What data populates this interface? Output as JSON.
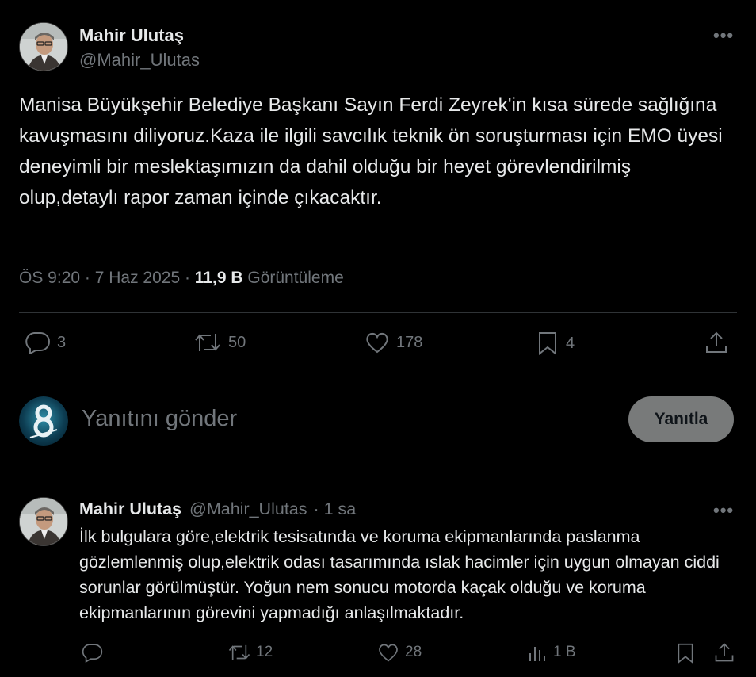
{
  "tweet": {
    "author_name": "Mahir Ulutaş",
    "author_handle": "@Mahir_Ulutas",
    "text": "Manisa Büyükşehir Belediye Başkanı Sayın Ferdi Zeyrek'in kısa sürede sağlığına kavuşmasını diliyoruz.Kaza ile ilgili savcılık teknik ön soruşturması için EMO üyesi deneyimli bir meslektaşımızın da dahil olduğu bir heyet görevlendirilmiş olup,detaylı rapor zaman içinde çıkacaktır.",
    "time": "ÖS 9:20 · 7 Haz 2025 ·",
    "views_count": "11,9 B",
    "views_label": "Görüntüleme",
    "replies": "3",
    "retweets": "50",
    "likes": "178",
    "bookmarks": "4"
  },
  "compose": {
    "placeholder": "Yanıtını gönder",
    "button_label": "Yanıtla"
  },
  "reply": {
    "author_name": "Mahir Ulutaş",
    "author_handle": "@Mahir_Ulutas",
    "time": "· 1 sa",
    "text": "İlk bulgulara göre,elektrik tesisatında ve koruma ekipmanlarında paslanma gözlemlenmiş olup,elektrik odası tasarımında ıslak hacimler için uygun olmayan ciddi sorunlar görülmüştür. Yoğun nem sonucu motorda kaçak olduğu ve koruma ekipmanlarının görevini yapmadığı anlaşılmaktadır.",
    "retweets": "12",
    "likes": "28",
    "views": "1 B"
  },
  "more_symbol": "•••"
}
